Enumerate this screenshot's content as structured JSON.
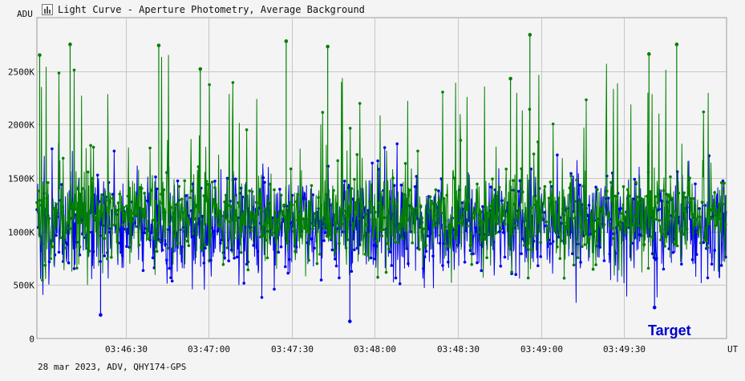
{
  "window": {
    "title": "Light Curve - Aperture Photometry, Average Background",
    "icon": "chart-icon"
  },
  "footer": {
    "text": "28 mar 2023, ADV, QHY174-GPS"
  },
  "colors": {
    "background": "#f4f4f4",
    "plot_background": "#f4f4f4",
    "grid": "#c6c6c6",
    "target_series": "#0000ee",
    "comparison_series": "#008000",
    "annotation": "#0000cc"
  },
  "chart_data": {
    "type": "line",
    "title": "Light Curve - Aperture Photometry, Average Background",
    "ylabel": "ADU",
    "xlabel": "UT",
    "ylim": [
      0,
      3000000
    ],
    "xlim": [
      "03:45:58",
      "03:50:07"
    ],
    "y_ticks": [
      "0",
      "500K",
      "1000K",
      "1500K",
      "2000K",
      "2500K"
    ],
    "y_tick_values": [
      0,
      500000,
      1000000,
      1500000,
      2000000,
      2500000
    ],
    "x_ticks": [
      "03:46:30",
      "03:47:00",
      "03:47:30",
      "03:48:00",
      "03:48:30",
      "03:49:00",
      "03:49:30"
    ],
    "grid": true,
    "annotation": "Target",
    "annotation_position": "bottom-right",
    "series": [
      {
        "name": "Target",
        "color": "#0000ee",
        "marker": "circle",
        "approx_points": 2500,
        "typical_min": 400000,
        "typical_max": 1800000,
        "mean": 1050000,
        "min": 150000,
        "max": 2000000
      },
      {
        "color": "#008000",
        "marker": "circle",
        "approx_points": 2500,
        "typical_min": 500000,
        "typical_max": 2000000,
        "mean": 1150000,
        "min": 200000,
        "max": 2850000
      }
    ],
    "highlighted_peaks": [
      {
        "time": "03:45:59",
        "value": 2650000
      },
      {
        "time": "03:46:10",
        "value": 2750000
      },
      {
        "time": "03:46:42",
        "value": 2740000
      },
      {
        "time": "03:46:57",
        "value": 2520000
      },
      {
        "time": "03:47:28",
        "value": 2780000
      },
      {
        "time": "03:47:43",
        "value": 2730000
      },
      {
        "time": "03:48:49",
        "value": 2430000
      },
      {
        "time": "03:48:56",
        "value": 2840000
      },
      {
        "time": "03:49:39",
        "value": 2660000
      },
      {
        "time": "03:49:49",
        "value": 2750000
      }
    ],
    "highlighted_dips": [
      {
        "time": "03:47:51",
        "value": 160000
      },
      {
        "time": "03:46:21",
        "value": 220000
      },
      {
        "time": "03:49:41",
        "value": 290000
      }
    ]
  }
}
